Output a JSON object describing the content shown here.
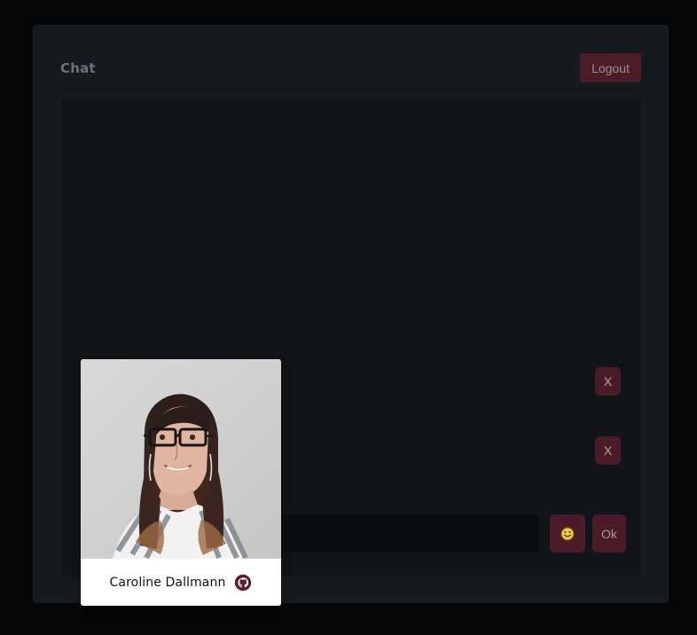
{
  "chat": {
    "title": "Chat",
    "logout_label": "Logout",
    "close_label_1": "X",
    "close_label_2": "X",
    "ok_label": "Ok",
    "emoji_icon": "emoji-icon"
  },
  "profile": {
    "name": "Caroline Dallmann",
    "github_icon": "github-icon"
  }
}
